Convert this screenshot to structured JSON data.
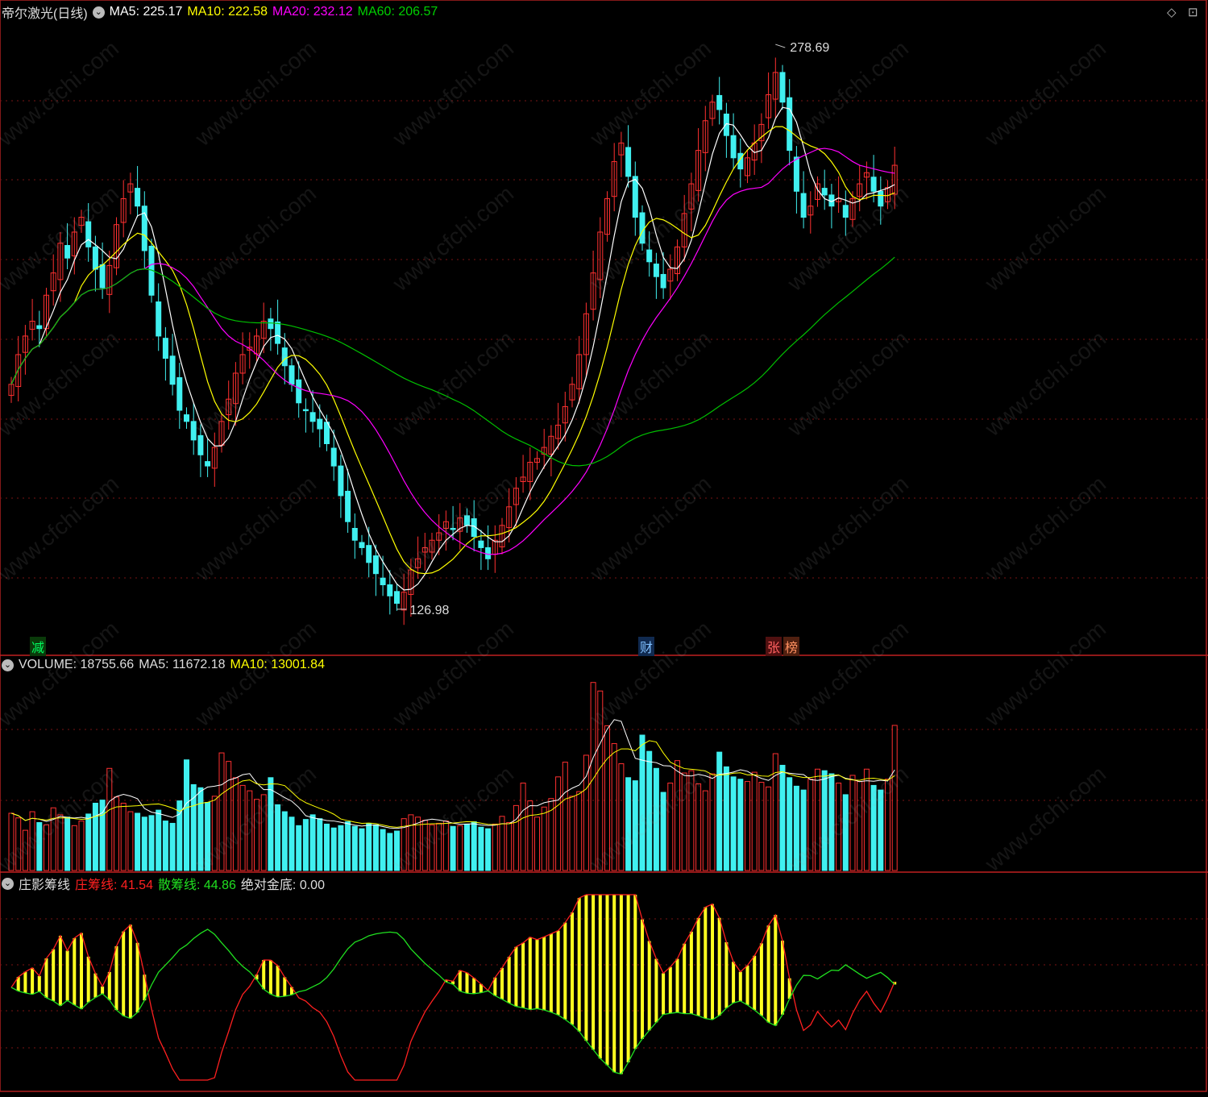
{
  "main": {
    "title": "帝尔激光(日线)",
    "ma5_label": "MA5: 225.17",
    "ma10_label": "MA10: 222.58",
    "ma20_label": "MA20: 232.12",
    "ma60_label": "MA60: 206.57",
    "high_label": "278.69",
    "low_label": "126.98",
    "markers": {
      "m1": "减",
      "m2": "财",
      "m3": "张",
      "m4": "榜"
    },
    "colors": {
      "ma5": "#ffffff",
      "ma10": "#ffff00",
      "ma20": "#ff00ff",
      "ma60": "#00c000",
      "up": "#ff3030",
      "down": "#40f0f0"
    }
  },
  "volume": {
    "label": "VOLUME: 18755.66",
    "ma5_label": "MA5: 11672.18",
    "ma10_label": "MA10: 13001.84"
  },
  "indicator": {
    "name": "庄影筹线",
    "zhuang_label": "庄筹线:",
    "zhuang_value": "41.54",
    "san_label": "散筹线:",
    "san_value": "44.86",
    "gold_label": "绝对金底:",
    "gold_value": "0.00"
  },
  "watermark": "www.cfchi.com",
  "chart_data": [
    {
      "type": "candlestick",
      "title": "帝尔激光(日线)",
      "ylim": [
        120,
        285
      ],
      "grid": true,
      "annotations": [
        "278.69",
        "126.98"
      ],
      "series_names": [
        "MA5",
        "MA10",
        "MA20",
        "MA60"
      ],
      "close": [
        188,
        196,
        201,
        205,
        203,
        212,
        218,
        226,
        222,
        229,
        233,
        225,
        219,
        214,
        220,
        231,
        238,
        242,
        236,
        224,
        212,
        201,
        195,
        188,
        181,
        178,
        173,
        169,
        166,
        171,
        178,
        184,
        191,
        196,
        198,
        201,
        205,
        203,
        199,
        193,
        188,
        183,
        181,
        178,
        176,
        172,
        166,
        158,
        151,
        146,
        144,
        140,
        137,
        134,
        131,
        129,
        132,
        138,
        141,
        144,
        146,
        148,
        151,
        149,
        152,
        150,
        147,
        144,
        141,
        146,
        150,
        155,
        160,
        163,
        167,
        168,
        171,
        174,
        177,
        182,
        188,
        196,
        207,
        218,
        229,
        238,
        248,
        253,
        244,
        233,
        226,
        221,
        217,
        214,
        219,
        225,
        234,
        242,
        251,
        259,
        264,
        262,
        255,
        249,
        246,
        249,
        253,
        258,
        266,
        272,
        264,
        251,
        240,
        233,
        236,
        242,
        239,
        236,
        238,
        233,
        238,
        242,
        245,
        240,
        236,
        241,
        247
      ],
      "vol": [
        7400,
        6800,
        5200,
        7600,
        6200,
        5900,
        8100,
        7200,
        6900,
        5800,
        6400,
        7300,
        8700,
        9100,
        13200,
        9500,
        8700,
        7600,
        7400,
        6900,
        7100,
        7800,
        6400,
        6100,
        9000,
        14300,
        11100,
        10700,
        8800,
        9600,
        15200,
        14100,
        12000,
        11000,
        10300,
        9200,
        9800,
        12000,
        8500,
        7600,
        6900,
        5800,
        6600,
        7200,
        6700,
        6000,
        5500,
        5800,
        6300,
        5700,
        5400,
        6100,
        5900,
        5300,
        4800,
        5100,
        6700,
        7200,
        6900,
        6500,
        5900,
        6100,
        6400,
        5700,
        5800,
        6000,
        6300,
        5600,
        5400,
        6000,
        7000,
        6200,
        8400,
        11300,
        9000,
        6900,
        8200,
        9300,
        12100,
        14000,
        9600,
        10200,
        14900,
        24300,
        23200,
        18700,
        16400,
        13800,
        12000,
        11600,
        17500,
        15400,
        13200,
        10100,
        11300,
        14200,
        12600,
        12900,
        11200,
        10300,
        12500,
        15300,
        13400,
        12100,
        11800,
        11500,
        12700,
        11400,
        10800,
        15100,
        13600,
        12000,
        10900,
        10400,
        11800,
        13100,
        12900,
        12500,
        11300,
        9800,
        12300,
        11500,
        13100,
        11000,
        10400,
        11800,
        18756
      ],
      "ylabel": "VOLUME"
    }
  ]
}
